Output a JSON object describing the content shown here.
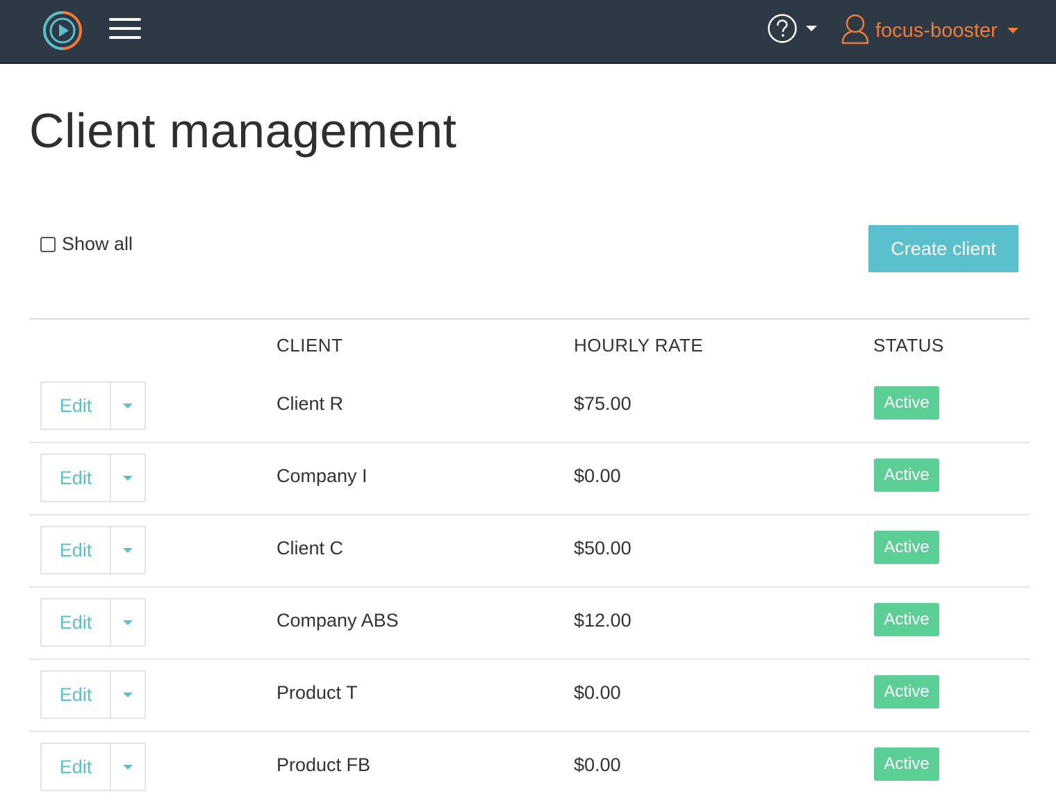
{
  "navbar": {
    "logo_icon": "play-circle-logo-icon",
    "menu_icon": "hamburger-menu-icon",
    "help_icon": "question-circle-icon",
    "user_icon": "user-outline-icon",
    "user_name": "focus-booster",
    "accent_color": "#f07c35",
    "background_color": "#2d3944"
  },
  "page": {
    "title": "Client management"
  },
  "controls": {
    "show_all_label": "Show all",
    "show_all_checked": false,
    "create_button_label": "Create client",
    "create_button_color": "#5bc0cd"
  },
  "table": {
    "headers": {
      "client": "CLIENT",
      "hourly_rate": "HOURLY RATE",
      "status": "STATUS"
    },
    "rows": [
      {
        "edit_label": "Edit",
        "client": "Client R",
        "rate": "$75.00",
        "status": "Active"
      },
      {
        "edit_label": "Edit",
        "client": "Company I",
        "rate": "$0.00",
        "status": "Active"
      },
      {
        "edit_label": "Edit",
        "client": "Client C",
        "rate": "$50.00",
        "status": "Active"
      },
      {
        "edit_label": "Edit",
        "client": "Company ABS",
        "rate": "$12.00",
        "status": "Active"
      },
      {
        "edit_label": "Edit",
        "client": "Product T",
        "rate": "$0.00",
        "status": "Active"
      },
      {
        "edit_label": "Edit",
        "client": "Product FB",
        "rate": "$0.00",
        "status": "Active"
      }
    ],
    "status_color": "#5ccf97"
  }
}
